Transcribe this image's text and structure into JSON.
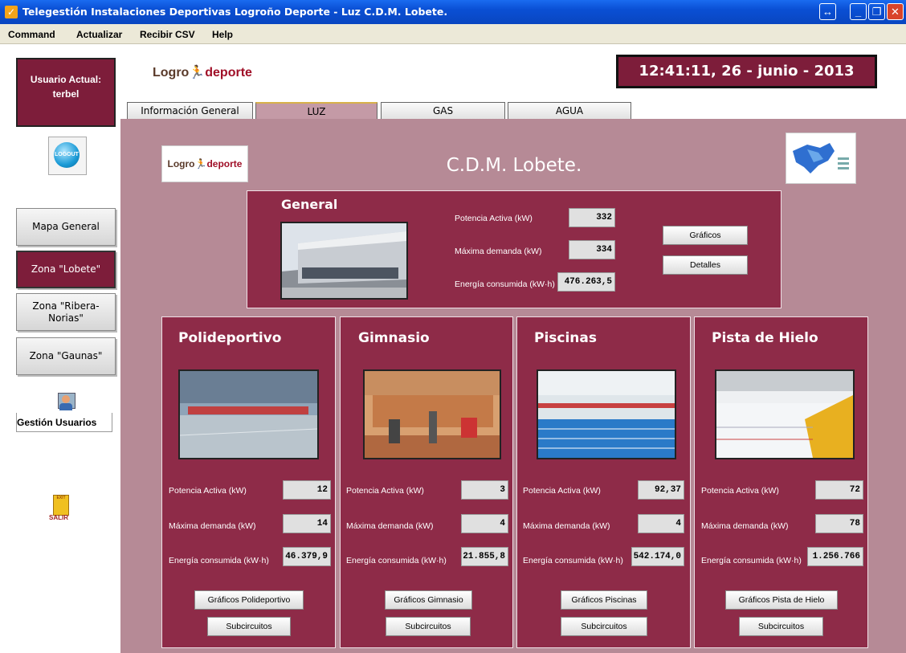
{
  "window": {
    "title": "Telegestión Instalaciones Deportivas Logroño Deporte - Luz C.D.M. Lobete."
  },
  "menu": [
    "Command",
    "Actualizar",
    "Recibir CSV",
    "Help"
  ],
  "user": {
    "label": "Usuario Actual:",
    "name": "terbel"
  },
  "logout_label": "LOGOUT",
  "nav": [
    "Mapa General",
    "Zona \"Lobete\"",
    "Zona \"Ribera-Norias\"",
    "Zona \"Gaunas\""
  ],
  "gestion_label": "Gestión Usuarios",
  "salir_label": "SALIR",
  "exit_label": "EXIT",
  "logo": {
    "a": "Logro",
    "b": "deporte"
  },
  "clock": "12:41:11, 26 - junio - 2013",
  "tabs": [
    "Información General",
    "LUZ",
    "GAS",
    "AGUA"
  ],
  "page_title": "C.D.M. Lobete.",
  "general": {
    "title": "General",
    "potencia_label": "Potencia Activa (kW)",
    "potencia": "332",
    "demanda_label": "Máxima demanda (kW)",
    "demanda": "334",
    "energia_label": "Energía consumida (kW·h)",
    "energia": "476.263,5",
    "graficos": "Gráficos",
    "detalles": "Detalles"
  },
  "zones": [
    {
      "title": "Polideportivo",
      "potencia": "12",
      "demanda": "14",
      "energia": "46.379,9",
      "graficos": "Gráficos Polideportivo",
      "sub": "Subcircuitos"
    },
    {
      "title": "Gimnasio",
      "potencia": "3",
      "demanda": "4",
      "energia": "21.855,8",
      "graficos": "Gráficos Gimnasio",
      "sub": "Subcircuitos"
    },
    {
      "title": "Piscinas",
      "potencia": "92,37",
      "demanda": "4",
      "energia": "542.174,0",
      "graficos": "Gráficos Piscinas",
      "sub": "Subcircuitos"
    },
    {
      "title": "Pista de Hielo",
      "potencia": "72",
      "demanda": "78",
      "energia": "1.256.766",
      "graficos": "Gráficos Pista de Hielo",
      "sub": "Subcircuitos"
    }
  ],
  "labels": {
    "potencia": "Potencia Activa (kW)",
    "demanda": "Máxima demanda (kW)",
    "energia": "Energía consumida (kW·h)"
  },
  "colors": {
    "accent": "#7d1d3a",
    "panel": "#8e2b48",
    "content_bg": "#b68a96",
    "titlebar": "#0a4fd4"
  }
}
